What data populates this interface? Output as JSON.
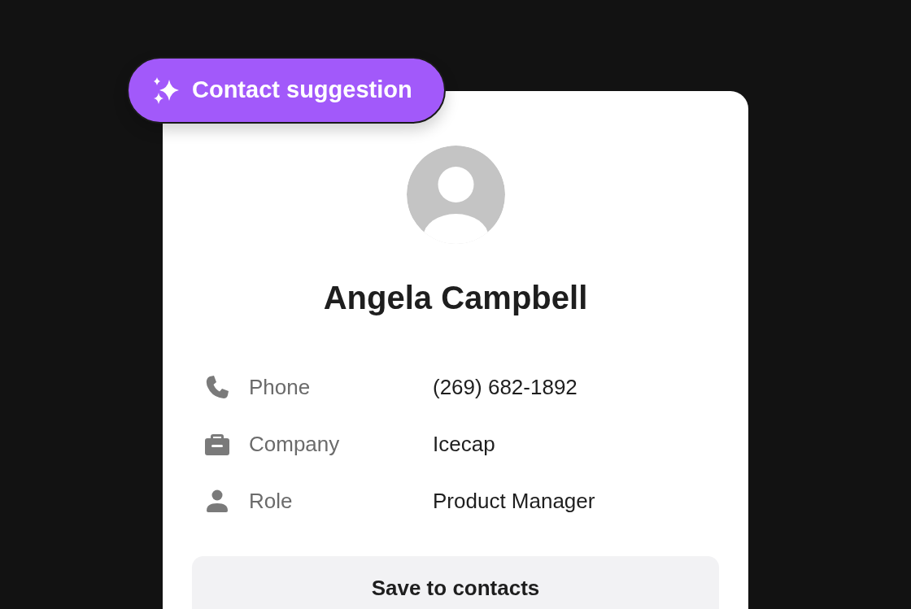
{
  "badge": {
    "label": "Contact suggestion"
  },
  "contact": {
    "name": "Angela Campbell"
  },
  "details": [
    {
      "kind": "phone",
      "label": "Phone",
      "value": "(269) 682-1892"
    },
    {
      "kind": "company",
      "label": "Company",
      "value": "Icecap"
    },
    {
      "kind": "role",
      "label": "Role",
      "value": "Product Manager"
    }
  ],
  "action": {
    "label": "Save to contacts"
  }
}
